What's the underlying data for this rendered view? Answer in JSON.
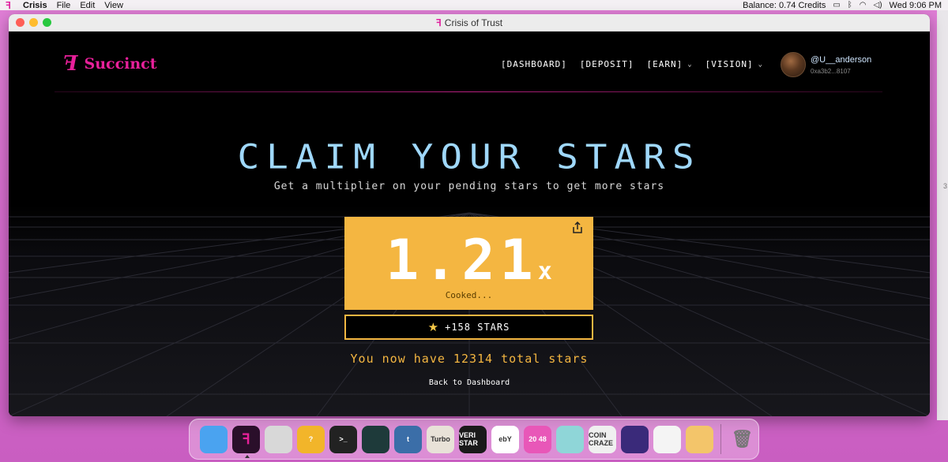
{
  "menubar": {
    "app_name": "Crisis",
    "menus": [
      "File",
      "Edit",
      "View"
    ],
    "balance": "Balance:  0.74 Credits",
    "clock": "Wed 9:06 PM"
  },
  "side_strip_text": "3",
  "window": {
    "title": "Crisis of Trust"
  },
  "header": {
    "brand": "Succinct",
    "nav": [
      {
        "label": "[DASHBOARD]",
        "has_dropdown": false
      },
      {
        "label": "[DEPOSIT]",
        "has_dropdown": false
      },
      {
        "label": "[EARN]",
        "has_dropdown": true
      },
      {
        "label": "[VISION]",
        "has_dropdown": true
      }
    ],
    "username": "@U__anderson",
    "address": "0xa3b2...8107"
  },
  "hero": {
    "title": "CLAIM YOUR STARS",
    "subtitle": "Get a multiplier on your pending stars to get more stars"
  },
  "multiplier": {
    "value": "1.21",
    "suffix": "x",
    "status": "Cooked..."
  },
  "reward": {
    "label": "+158 STARS"
  },
  "summary": {
    "text": "You now have 12314 total stars"
  },
  "back_link": "Back to Dashboard",
  "colors": {
    "accent_pink": "#e8209a",
    "title_blue": "#9fd8fb",
    "gold": "#f4b641"
  },
  "dock": {
    "apps": [
      {
        "name": "finder-icon",
        "label": "",
        "bg": "#4aa3f0"
      },
      {
        "name": "crisis-icon",
        "label": "",
        "bg": "#2a0f2a"
      },
      {
        "name": "globe-icon",
        "label": "",
        "bg": "#d8d8d8"
      },
      {
        "name": "question-icon",
        "label": "?",
        "bg": "#f2b52a"
      },
      {
        "name": "terminal-icon",
        "label": ">_",
        "bg": "#222"
      },
      {
        "name": "monitor-icon",
        "label": "",
        "bg": "#1e3a3a"
      },
      {
        "name": "tumblr-icon",
        "label": "t",
        "bg": "#3b6ea8"
      },
      {
        "name": "turbo-icon",
        "label": "Turbo",
        "bg": "#e8e2d8"
      },
      {
        "name": "verstar-icon",
        "label": "VERI STAR",
        "bg": "#1a1a1a"
      },
      {
        "name": "ebay-icon",
        "label": "ebY",
        "bg": "#ffffff"
      },
      {
        "name": "game-2048-icon",
        "label": "20 48",
        "bg": "#e857b8"
      },
      {
        "name": "cat-game-icon",
        "label": "",
        "bg": "#8fd6d8"
      },
      {
        "name": "coin-craze-icon",
        "label": "COIN CRAZE",
        "bg": "#f0f0f0"
      },
      {
        "name": "monster-game-icon",
        "label": "",
        "bg": "#3a2a7a"
      },
      {
        "name": "blocks-game-icon",
        "label": "",
        "bg": "#f4f4f4"
      },
      {
        "name": "face-game-icon",
        "label": "",
        "bg": "#f3c56a"
      },
      {
        "name": "trash-icon",
        "label": "",
        "bg": "transparent"
      }
    ]
  }
}
